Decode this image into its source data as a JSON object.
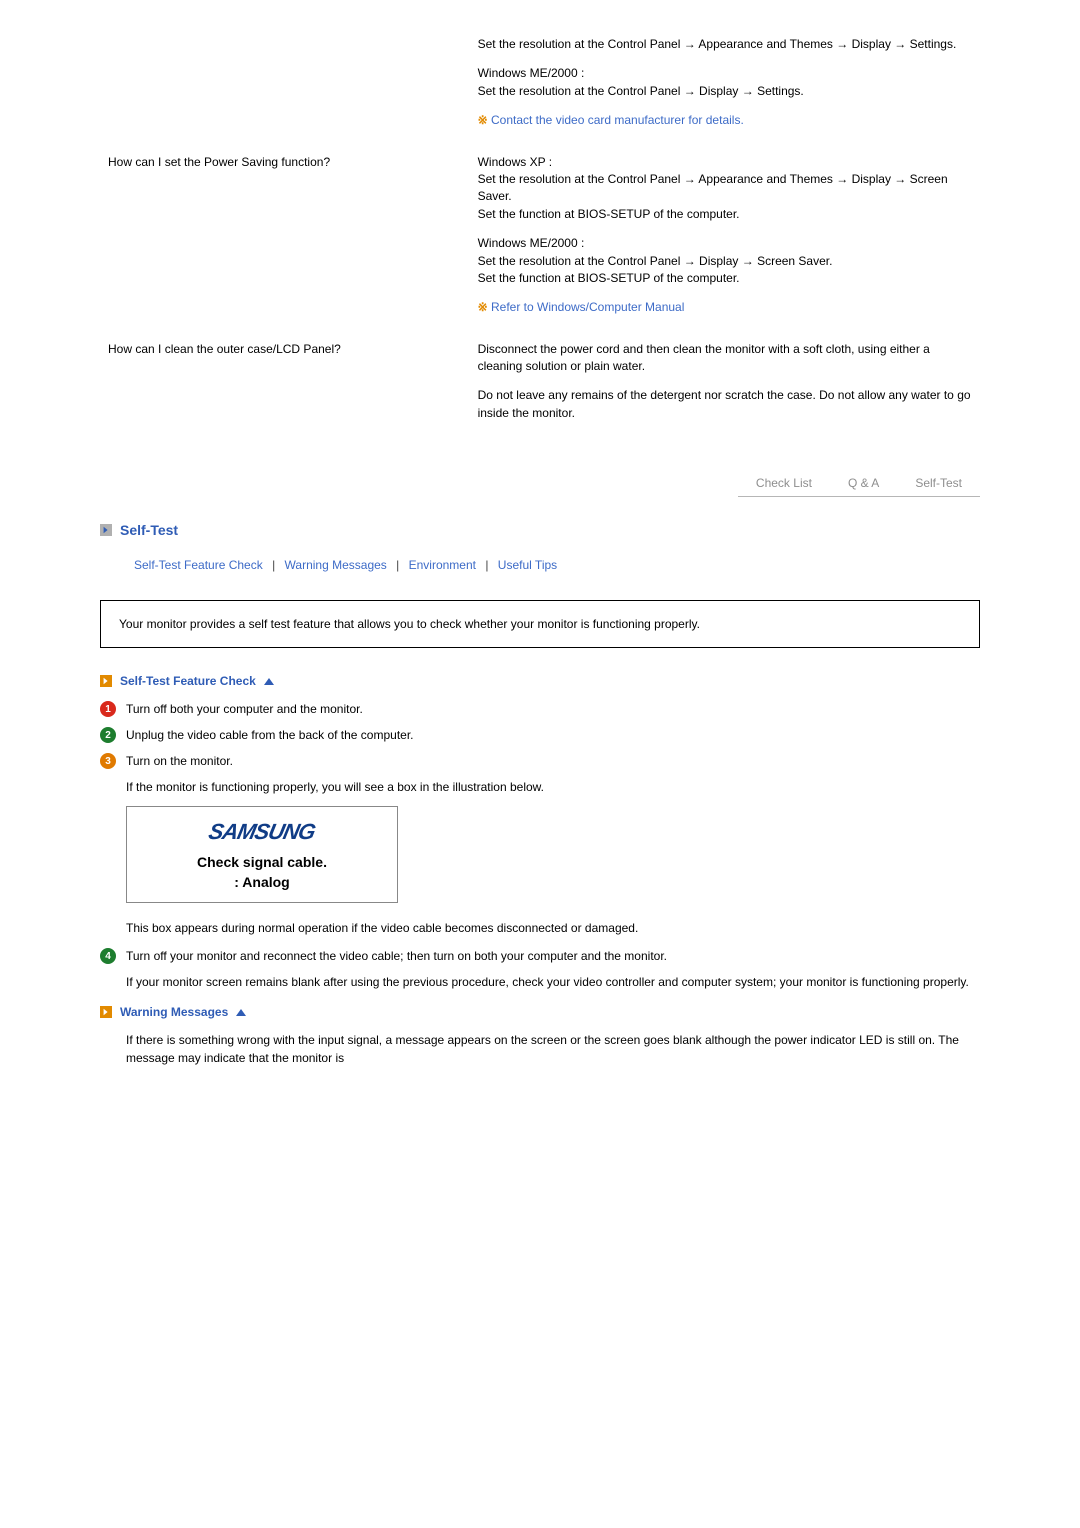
{
  "qa": [
    {
      "question": "",
      "answers": [
        {
          "text": "Set the resolution at the Control Panel → Appearance and Themes → Display → Settings."
        },
        {
          "text": "Windows ME/2000 :\nSet the resolution at the Control Panel → Display → Settings."
        },
        {
          "note": "Contact the video card manufacturer for details."
        }
      ]
    },
    {
      "question": "How can I set the Power Saving function?",
      "answers": [
        {
          "text": "Windows XP :\nSet the resolution at the Control Panel → Appearance and Themes → Display → Screen Saver.\nSet the function at BIOS-SETUP of the computer."
        },
        {
          "text": "Windows ME/2000 :\nSet the resolution at the Control Panel → Display → Screen Saver.\nSet the function at BIOS-SETUP of the computer."
        },
        {
          "note": "Refer to Windows/Computer Manual"
        }
      ]
    },
    {
      "question": "How can I clean the outer case/LCD Panel?",
      "answers": [
        {
          "text": "Disconnect the power cord and then clean the monitor with a soft cloth, using either a cleaning solution or plain water."
        },
        {
          "text": "Do not leave any remains of the detergent nor scratch the case. Do not allow any water to go inside the monitor."
        }
      ]
    }
  ],
  "tabs": {
    "check_list": "Check List",
    "qa": "Q & A",
    "self_test": "Self-Test"
  },
  "section": {
    "self_test_title": "Self-Test",
    "anchors": {
      "a1": "Self-Test Feature Check",
      "a2": "Warning Messages",
      "a3": "Environment",
      "a4": "Useful Tips"
    },
    "intro": "Your monitor provides a self test feature that allows you to check whether your monitor is functioning properly.",
    "sub1_title": "Self-Test Feature Check",
    "steps": [
      "Turn off both your computer and the monitor.",
      "Unplug the video cable from the back of the computer.",
      "Turn on the monitor."
    ],
    "step3_extra": "If the monitor is functioning properly, you will see a box in the illustration below.",
    "msgbox": {
      "logo": "SAMSUNG",
      "line1": "Check signal cable.",
      "line2": ":    Analog"
    },
    "after_box": "This box appears during normal operation if the video cable becomes disconnected or damaged.",
    "step4": "Turn off your monitor and reconnect the video cable; then turn on both your computer and the monitor.",
    "step4_extra": "If your monitor screen remains blank after using the previous procedure, check your video controller and computer system; your monitor is functioning properly.",
    "sub2_title": "Warning Messages",
    "warning_text": "If there is something wrong with the input signal, a message appears on the screen or the screen goes blank although the power indicator LED is still on. The message may indicate that the monitor is"
  }
}
